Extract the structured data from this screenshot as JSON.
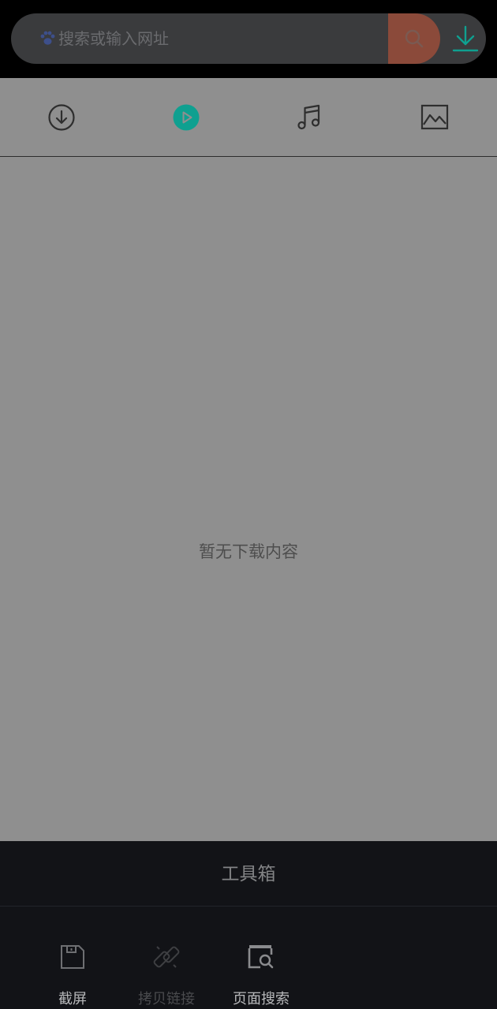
{
  "search": {
    "placeholder": "搜索或输入网址"
  },
  "tabs": [
    {
      "name": "download",
      "icon": "download-circle-icon",
      "active": false
    },
    {
      "name": "video",
      "icon": "play-circle-icon",
      "active": true
    },
    {
      "name": "music",
      "icon": "music-note-icon",
      "active": false
    },
    {
      "name": "image",
      "icon": "image-icon",
      "active": false
    }
  ],
  "content": {
    "empty_message": "暂无下载内容"
  },
  "toolbox": {
    "title": "工具箱",
    "tools": [
      {
        "label": "截屏",
        "icon": "screenshot-icon",
        "enabled": true
      },
      {
        "label": "拷贝链接",
        "icon": "link-icon",
        "enabled": false
      },
      {
        "label": "页面搜索",
        "icon": "page-search-icon",
        "enabled": true
      }
    ]
  },
  "colors": {
    "accent": "#0fa090",
    "search_button": "#8b4a3a",
    "panel": "#8f8f8f",
    "toolbox_bg": "#121317"
  }
}
